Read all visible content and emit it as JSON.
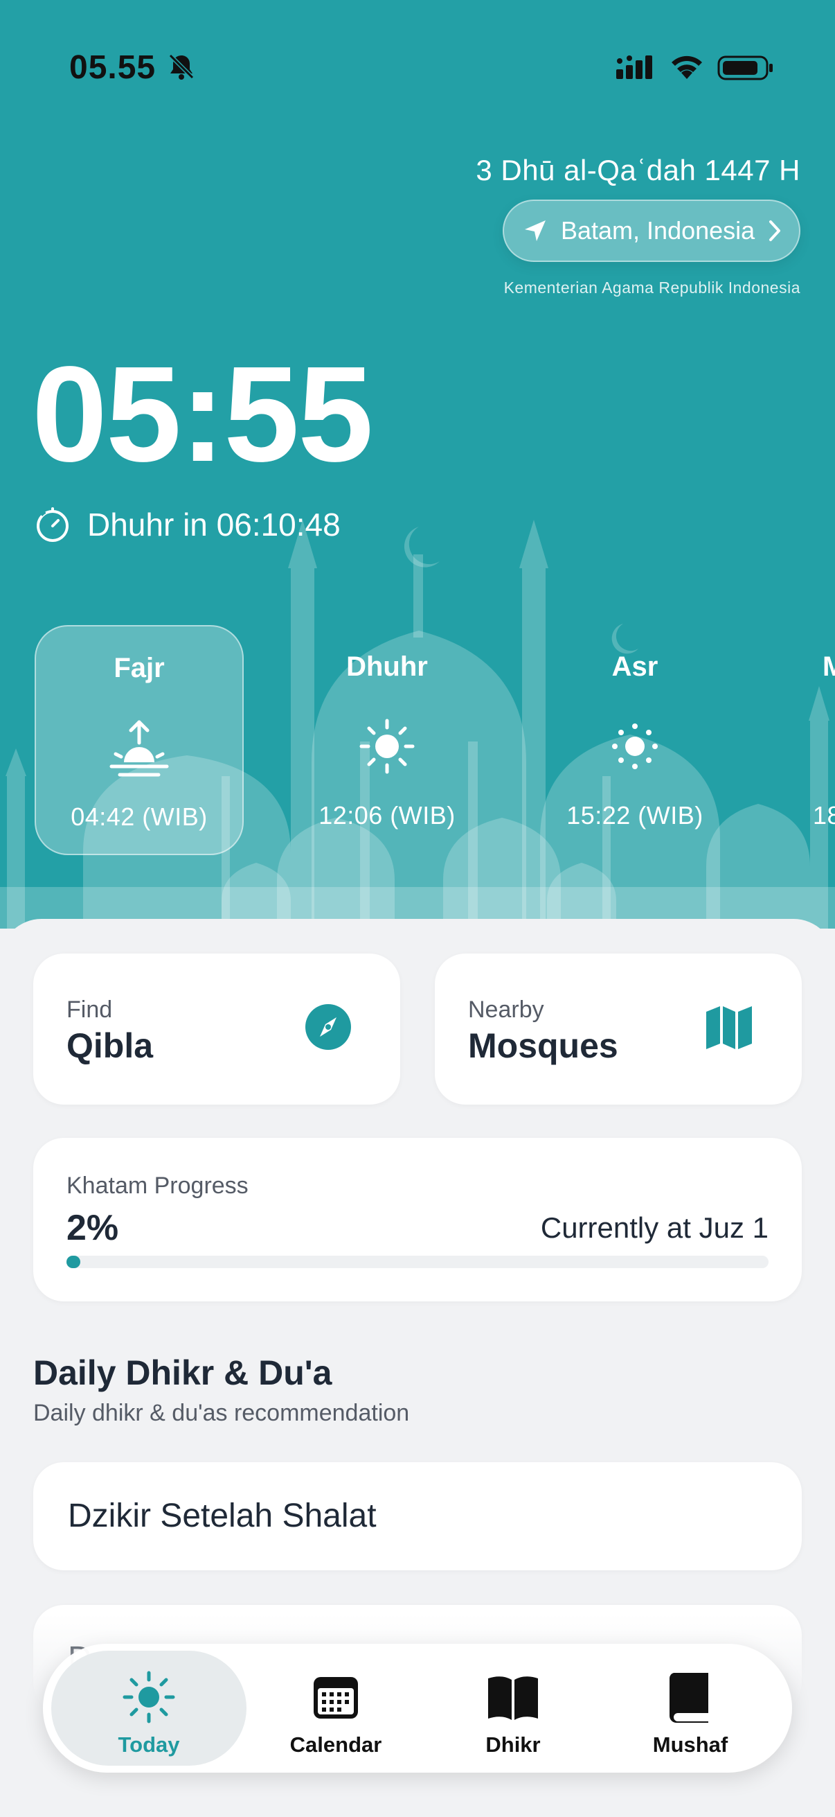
{
  "status_bar": {
    "time": "05.55"
  },
  "header": {
    "hijri_date": "3 Dhū al-Qaʿdah 1447 H",
    "location": "Batam, Indonesia",
    "source": "Kementerian Agama Republik Indonesia",
    "current_time": "05:55",
    "countdown": "Dhuhr in 06:10:48"
  },
  "prayers": [
    {
      "name": "Fajr",
      "time": "04:42 (WIB)",
      "icon": "sunrise-icon",
      "active": true
    },
    {
      "name": "Dhuhr",
      "time": "12:06 (WIB)",
      "icon": "sun-icon",
      "active": false
    },
    {
      "name": "Asr",
      "time": "15:22 (WIB)",
      "icon": "sun-icon",
      "active": false
    },
    {
      "name": "M",
      "time": "18",
      "icon": "",
      "active": false
    }
  ],
  "quick_actions": {
    "qibla": {
      "sub": "Find",
      "title": "Qibla",
      "icon": "compass-icon"
    },
    "mosques": {
      "sub": "Nearby",
      "title": "Mosques",
      "icon": "map-icon"
    }
  },
  "khatam": {
    "label": "Khatam Progress",
    "percent_label": "2%",
    "progress": 0.02,
    "juz": "Currently at Juz 1"
  },
  "daily": {
    "title": "Daily Dhikr & Du'a",
    "subtitle": "Daily dhikr & du'as recommendation",
    "items": [
      "Dzikir Setelah Shalat",
      "D"
    ]
  },
  "tabs": [
    {
      "label": "Today",
      "icon": "sun-icon",
      "active": true
    },
    {
      "label": "Calendar",
      "icon": "calendar-icon",
      "active": false
    },
    {
      "label": "Dhikr",
      "icon": "book-open-icon",
      "active": false
    },
    {
      "label": "Mushaf",
      "icon": "book-icon",
      "active": false
    }
  ],
  "colors": {
    "teal": "#23a0a6",
    "accent": "#1f9aa0",
    "background": "#f1f2f4"
  }
}
